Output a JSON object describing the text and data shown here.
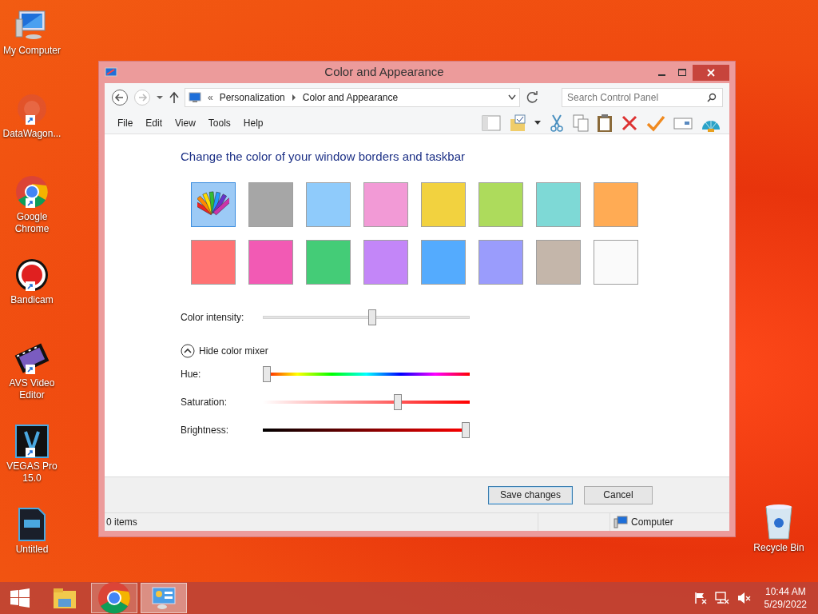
{
  "desktop_icons": [
    {
      "label": "My Computer",
      "kind": "computer",
      "shortcut": false
    },
    {
      "label": "DataWagon...",
      "kind": "blur",
      "shortcut": true
    },
    {
      "label": "Google Chrome",
      "kind": "chrome",
      "shortcut": true
    },
    {
      "label": "Bandicam",
      "kind": "record",
      "shortcut": true
    },
    {
      "label": "AVS Video Editor",
      "kind": "film",
      "shortcut": true
    },
    {
      "label": "VEGAS Pro 15.0",
      "kind": "vegas",
      "shortcut": true
    },
    {
      "label": "Untitled",
      "kind": "veg",
      "shortcut": false
    }
  ],
  "recycle_bin": {
    "label": "Recycle Bin"
  },
  "window": {
    "title": "Color and Appearance",
    "address": {
      "prefix": "«",
      "crumbs": [
        "Personalization",
        "Color and Appearance"
      ]
    },
    "search": {
      "placeholder": "Search Control Panel"
    },
    "menu": [
      "File",
      "Edit",
      "View",
      "Tools",
      "Help"
    ],
    "heading": "Change the color of your window borders and taskbar",
    "swatches": [
      {
        "kind": "palette",
        "selected": true
      },
      {
        "kind": "color",
        "color": "#a6a6a6",
        "selected": false
      },
      {
        "kind": "color",
        "color": "#8fcbfb",
        "selected": false
      },
      {
        "kind": "color",
        "color": "#f29ad6",
        "selected": false
      },
      {
        "kind": "color",
        "color": "#f2d23f",
        "selected": false
      },
      {
        "kind": "color",
        "color": "#addb5c",
        "selected": false
      },
      {
        "kind": "color",
        "color": "#7ed9d6",
        "selected": false
      },
      {
        "kind": "color",
        "color": "#ffab54",
        "selected": false
      },
      {
        "kind": "color",
        "color": "#ff7273",
        "selected": false
      },
      {
        "kind": "color",
        "color": "#f25ab4",
        "selected": false
      },
      {
        "kind": "color",
        "color": "#44cc77",
        "selected": false
      },
      {
        "kind": "color",
        "color": "#c386f8",
        "selected": false
      },
      {
        "kind": "color",
        "color": "#54abfe",
        "selected": false
      },
      {
        "kind": "color",
        "color": "#9a9cfc",
        "selected": false
      },
      {
        "kind": "color",
        "color": "#c4b6aa",
        "selected": false
      },
      {
        "kind": "color",
        "color": "#fafafa",
        "selected": false
      }
    ],
    "intensity": {
      "label": "Color intensity:",
      "level": 0.53
    },
    "mixer": {
      "label": "Hide color mixer",
      "expanded": true,
      "sliders": [
        {
          "label": "Hue:",
          "kind": "hue",
          "level": 0.0
        },
        {
          "label": "Saturation:",
          "kind": "saturation",
          "level": 0.66
        },
        {
          "label": "Brightness:",
          "kind": "brightness",
          "level": 1.0
        }
      ]
    },
    "buttons": [
      {
        "label": "Save changes",
        "default": true
      },
      {
        "label": "Cancel",
        "default": false
      }
    ],
    "status_bar": {
      "items": "0 items",
      "location": "Computer"
    }
  },
  "taskbar": {
    "apps": [
      {
        "kind": "explorer",
        "running": false,
        "selected": false
      },
      {
        "kind": "chrome",
        "running": true,
        "selected": false
      },
      {
        "kind": "control-panel",
        "running": true,
        "selected": true
      }
    ],
    "time": "10:44 AM",
    "date": "5/29/2022"
  }
}
